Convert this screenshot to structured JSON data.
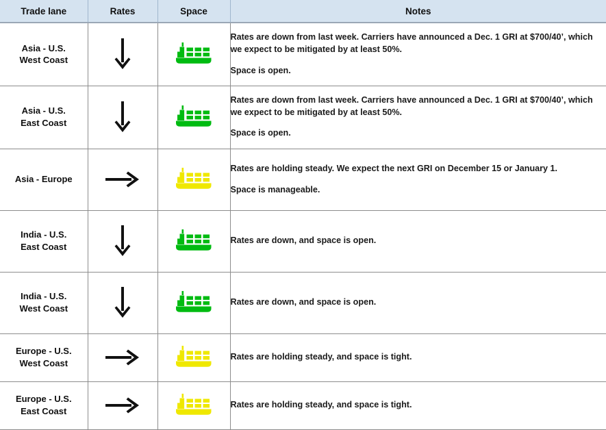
{
  "table": {
    "name": "trade-lane-market-update",
    "columns": [
      {
        "key": "lane",
        "label": "Trade lane"
      },
      {
        "key": "rates",
        "label": "Rates"
      },
      {
        "key": "space",
        "label": "Space"
      },
      {
        "key": "notes",
        "label": "Notes"
      }
    ],
    "header_background": "#d5e3f0",
    "border_color": "#8c8c8c",
    "rows": [
      {
        "lane": "Asia - U.S. West Coast",
        "lane_line1": "Asia - U.S.",
        "lane_line2": "West Coast",
        "rates_icon": "arrow-down-icon",
        "rates_direction": "down",
        "space_icon": "cargo-ship-icon",
        "space_status": "open",
        "space_color": "#00bb11",
        "notes_paragraph_1": "Rates are down from last week. Carriers have announced a Dec. 1 GRI at $700/40’, which we expect to be mitigated by at least 50%.",
        "notes_paragraph_2": "Space is open."
      },
      {
        "lane": "Asia - U.S. East Coast",
        "lane_line1": "Asia - U.S.",
        "lane_line2": "East Coast",
        "rates_icon": "arrow-down-icon",
        "rates_direction": "down",
        "space_icon": "cargo-ship-icon",
        "space_status": "open",
        "space_color": "#00bb11",
        "notes_paragraph_1": "Rates are down from last week. Carriers have announced a Dec. 1 GRI at $700/40’, which we expect to be mitigated by at least 50%.",
        "notes_paragraph_2": "Space is open."
      },
      {
        "lane": "Asia - Europe",
        "lane_line1": "Asia - Europe",
        "lane_line2": "",
        "rates_icon": "arrow-right-icon",
        "rates_direction": "steady",
        "space_icon": "cargo-ship-icon",
        "space_status": "manageable",
        "space_color": "#efe800",
        "notes_paragraph_1": "Rates are holding steady. We expect the next GRI on December 15 or January 1.",
        "notes_paragraph_2": "Space is manageable."
      },
      {
        "lane": "India - U.S. East Coast",
        "lane_line1": "India - U.S.",
        "lane_line2": "East Coast",
        "rates_icon": "arrow-down-icon",
        "rates_direction": "down",
        "space_icon": "cargo-ship-icon",
        "space_status": "open",
        "space_color": "#00bb11",
        "notes_paragraph_1": "Rates are down, and space is open.",
        "notes_paragraph_2": ""
      },
      {
        "lane": "India - U.S. West Coast",
        "lane_line1": "India - U.S.",
        "lane_line2": "West Coast",
        "rates_icon": "arrow-down-icon",
        "rates_direction": "down",
        "space_icon": "cargo-ship-icon",
        "space_status": "open",
        "space_color": "#00bb11",
        "notes_paragraph_1": "Rates are down, and space is open.",
        "notes_paragraph_2": ""
      },
      {
        "lane": "Europe - U.S. West Coast",
        "lane_line1": "Europe - U.S.",
        "lane_line2": "West Coast",
        "rates_icon": "arrow-right-icon",
        "rates_direction": "steady",
        "space_icon": "cargo-ship-icon",
        "space_status": "tight",
        "space_color": "#efe800",
        "notes_paragraph_1": "Rates are holding steady, and space is tight.",
        "notes_paragraph_2": ""
      },
      {
        "lane": "Europe - U.S. East Coast",
        "lane_line1": "Europe - U.S.",
        "lane_line2": "East Coast",
        "rates_icon": "arrow-right-icon",
        "rates_direction": "steady",
        "space_icon": "cargo-ship-icon",
        "space_status": "tight",
        "space_color": "#efe800",
        "notes_paragraph_1": "Rates are holding steady, and space is tight.",
        "notes_paragraph_2": ""
      }
    ]
  }
}
